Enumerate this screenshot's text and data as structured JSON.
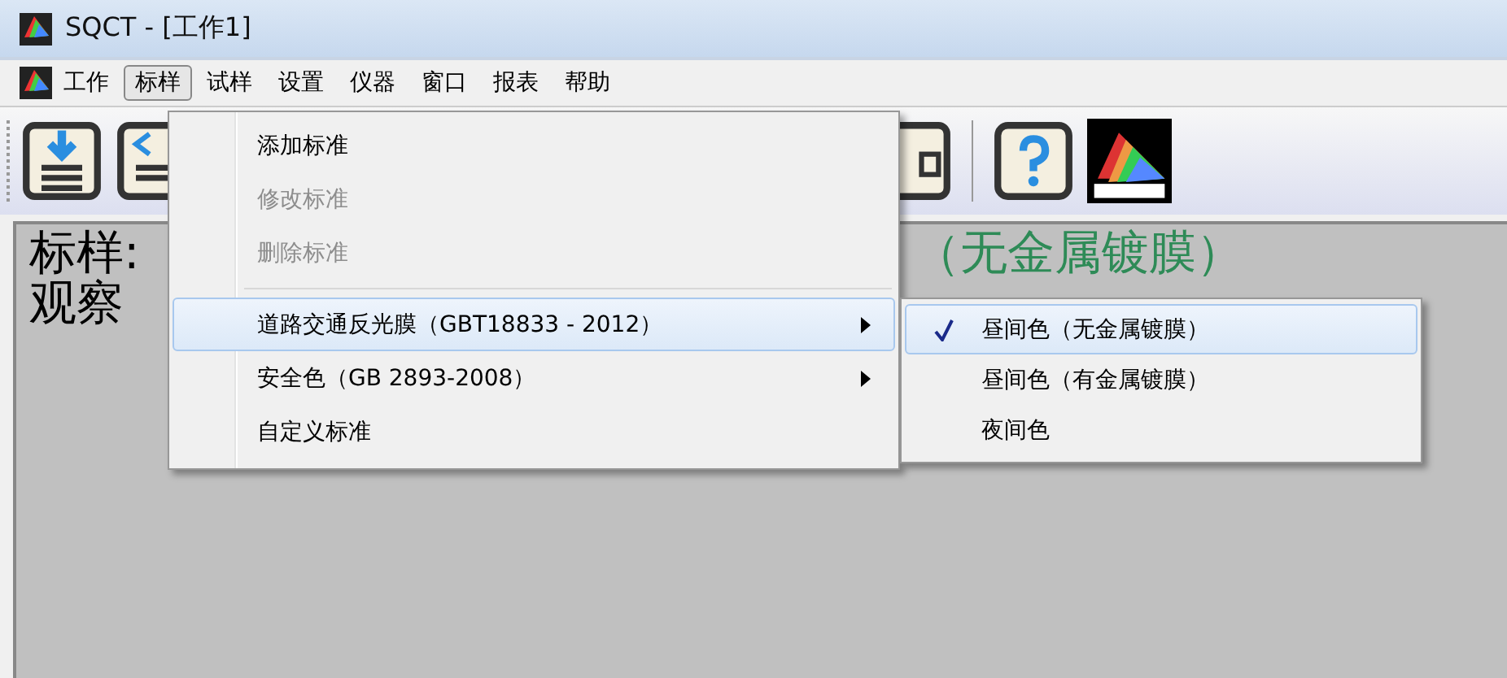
{
  "window": {
    "title": "SQCT - [工作1]"
  },
  "menu_bar": [
    {
      "label": "工作",
      "selected": false
    },
    {
      "label": "标样",
      "selected": true
    },
    {
      "label": "试样",
      "selected": false
    },
    {
      "label": "设置",
      "selected": false
    },
    {
      "label": "仪器",
      "selected": false
    },
    {
      "label": "窗口",
      "selected": false
    },
    {
      "label": "报表",
      "selected": false
    },
    {
      "label": "帮助",
      "selected": false
    }
  ],
  "content": {
    "sample_label": "标样:",
    "observer_label": "观察",
    "standard_name": "（无金属镀膜）"
  },
  "standard_menu": [
    {
      "kind": "item",
      "label": "添加标准",
      "disabled": false,
      "submenu": false,
      "highlighted": false
    },
    {
      "kind": "item",
      "label": "修改标准",
      "disabled": true,
      "submenu": false,
      "highlighted": false
    },
    {
      "kind": "item",
      "label": "删除标准",
      "disabled": true,
      "submenu": false,
      "highlighted": false
    },
    {
      "kind": "separator"
    },
    {
      "kind": "item",
      "label": "道路交通反光膜（GBT18833 - 2012）",
      "disabled": false,
      "submenu": true,
      "highlighted": true
    },
    {
      "kind": "item",
      "label": "安全色（GB 2893-2008）",
      "disabled": false,
      "submenu": true,
      "highlighted": false
    },
    {
      "kind": "item",
      "label": "自定义标准",
      "disabled": false,
      "submenu": false,
      "highlighted": false
    }
  ],
  "submenu": [
    {
      "label": "昼间色（无金属镀膜）",
      "checked": true,
      "highlighted": true
    },
    {
      "label": "昼间色（有金属镀膜）",
      "checked": false,
      "highlighted": false
    },
    {
      "label": "夜间色",
      "checked": false,
      "highlighted": false
    }
  ]
}
